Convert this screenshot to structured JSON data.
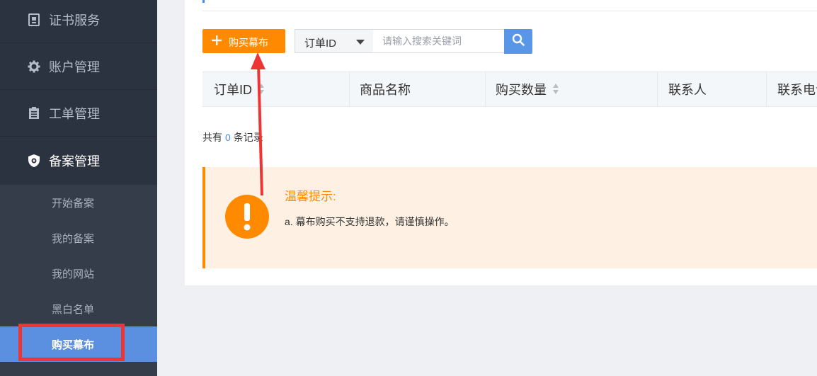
{
  "sidebar": {
    "items": [
      {
        "label": "证书服务",
        "icon": "certificate-icon"
      },
      {
        "label": "账户管理",
        "icon": "gear-icon"
      },
      {
        "label": "工单管理",
        "icon": "clipboard-icon"
      },
      {
        "label": "备案管理",
        "icon": "shield-icon"
      }
    ],
    "submenu": [
      {
        "label": "开始备案"
      },
      {
        "label": "我的备案"
      },
      {
        "label": "我的网站"
      },
      {
        "label": "黑白名单"
      },
      {
        "label": "购买幕布"
      }
    ]
  },
  "toolbar": {
    "buy_label": "购买幕布",
    "select_value": "订单ID",
    "search_placeholder": "请输入搜索关键词"
  },
  "table": {
    "columns": [
      "订单ID",
      "商品名称",
      "购买数量",
      "联系人",
      "联系电话"
    ]
  },
  "records": {
    "prefix": "共有",
    "count": "0",
    "suffix": "条记录"
  },
  "notice": {
    "title": "温馨提示:",
    "body": "a. 幕布购买不支持退款，请谨慎操作。"
  },
  "colors": {
    "sidebar_bg": "#2c3340",
    "accent_orange": "#ff8a00",
    "accent_blue": "#5a96e8",
    "annotation_red": "#ee3535"
  }
}
